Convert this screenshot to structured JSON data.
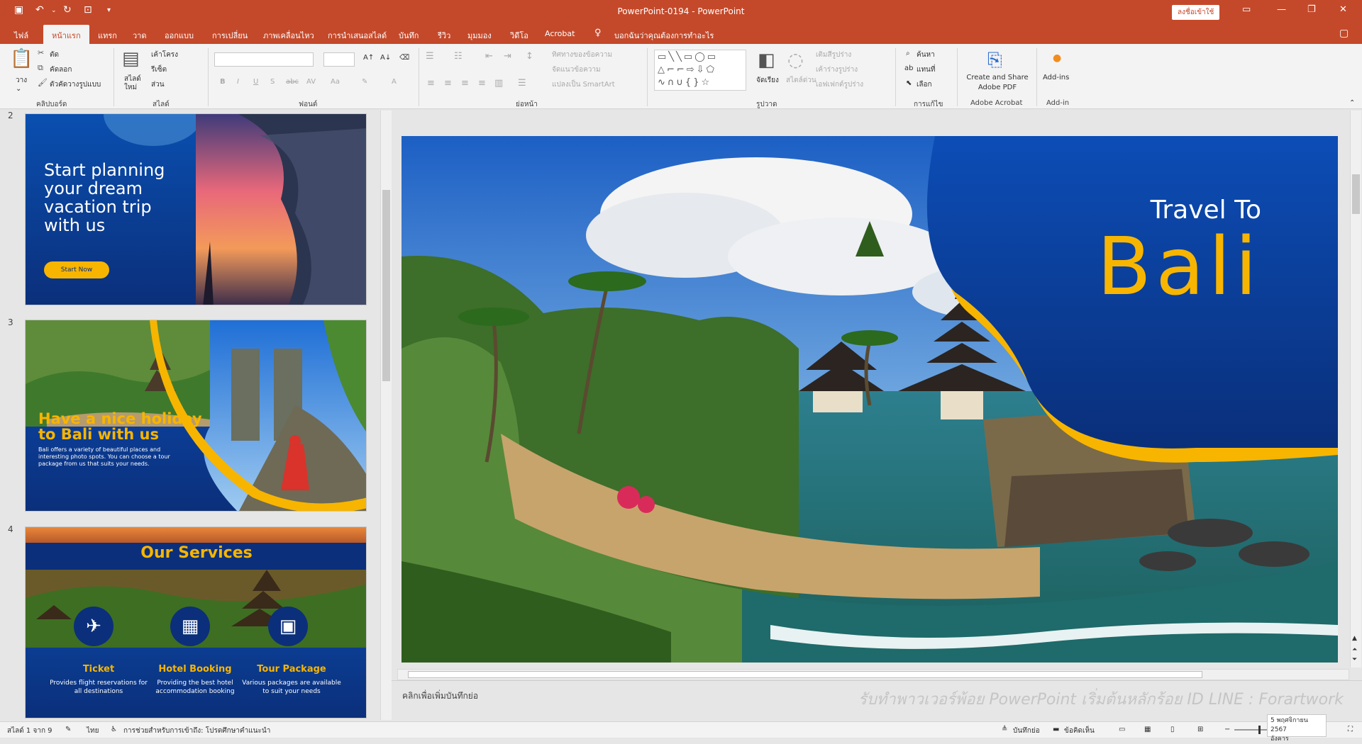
{
  "app": {
    "title": "PowerPoint-0194 - PowerPoint",
    "signin_label": "ลงชื่อเข้าใช้",
    "accent": "#c4492a"
  },
  "quick_access": {
    "icons": [
      "save-icon",
      "undo-icon",
      "redo-icon",
      "slideshow-icon",
      "customize-icon"
    ]
  },
  "tabs": [
    {
      "label": "ไฟล์"
    },
    {
      "label": "หน้าแรก",
      "active": true
    },
    {
      "label": "แทรก"
    },
    {
      "label": "วาด"
    },
    {
      "label": "ออกแบบ"
    },
    {
      "label": "การเปลี่ยน"
    },
    {
      "label": "ภาพเคลื่อนไหว"
    },
    {
      "label": "การนำเสนอสไลด์"
    },
    {
      "label": "บันทึก"
    },
    {
      "label": "รีวิว"
    },
    {
      "label": "มุมมอง"
    },
    {
      "label": "วิดีโอ"
    },
    {
      "label": "Acrobat"
    }
  ],
  "tell_me": "บอกฉันว่าคุณต้องการทำอะไร",
  "ribbon": {
    "clipboard": {
      "paste": "วาง",
      "cut": "ตัด",
      "copy": "คัดลอก",
      "format_painter": "ตัวคัดวางรูปแบบ",
      "label": "คลิปบอร์ด"
    },
    "slides": {
      "new_slide": "สไลด์ใหม่",
      "layout": "เค้าโครง",
      "reset": "รีเซ็ต",
      "section": "ส่วน",
      "label": "สไลด์"
    },
    "font": {
      "label": "ฟอนต์",
      "bold": "B",
      "italic": "I",
      "underline": "U",
      "shadow": "S",
      "strike": "abc",
      "case": "Aa"
    },
    "paragraph": {
      "text_direction": "ทิศทางของข้อความ",
      "align_text": "จัดแนวข้อความ",
      "smartart": "แปลงเป็น SmartArt",
      "label": "ย่อหน้า"
    },
    "drawing": {
      "arrange": "จัดเรียง",
      "quick_styles": "สไตล์ด่วน",
      "fill": "เติมสีรูปร่าง",
      "outline": "เค้าร่างรูปร่าง",
      "effects": "เอฟเฟกต์รูปร่าง",
      "label": "รูปวาด"
    },
    "editing": {
      "find": "ค้นหา",
      "replace": "แทนที่",
      "select": "เลือก",
      "label": "การแก้ไข"
    },
    "acrobat": {
      "line1": "Create and Share",
      "line2": "Adobe PDF",
      "label": "Adobe Acrobat"
    },
    "addins": {
      "button": "Add-ins",
      "label": "Add-in"
    }
  },
  "thumbnails": [
    {
      "number": "2",
      "heading": "Start planning your dream vacation trip with us",
      "button": "Start Now"
    },
    {
      "number": "3",
      "heading": "Have a nice holiday to Bali with us",
      "body": "Bali offers a variety of beautiful places and interesting photo spots. You can choose a tour package from us that suits your needs."
    },
    {
      "number": "4",
      "heading": "Our Services",
      "services": [
        {
          "title": "Ticket",
          "desc": "Provides flight reservations for all destinations",
          "icon": "plane-icon"
        },
        {
          "title": "Hotel Booking",
          "desc": "Providing the best hotel accommodation booking",
          "icon": "hotel-icon"
        },
        {
          "title": "Tour Package",
          "desc": "Various packages are available to suit your needs",
          "icon": "luggage-icon"
        }
      ]
    }
  ],
  "main_slide": {
    "line1": "Travel To",
    "line2": "Bali"
  },
  "notes": {
    "placeholder": "คลิกเพื่อเพิ่มบันทึกย่อ",
    "watermark": "รับทำพาวเวอร์พ้อย PowerPoint เริ่มต้นหลักร้อย ID LINE : Forartwork"
  },
  "status": {
    "slide_counter": "สไลด์ 1 จาก 9",
    "language": "ไทย",
    "accessibility": "การช่วยสำหรับการเข้าถึง: โปรดศึกษาคำแนะนำ",
    "notes_btn": "บันทึกย่อ",
    "comments_btn": "ข้อคิดเห็น",
    "date": "5 พฤศจิกายน 2567",
    "day": "อังคาร"
  },
  "colors": {
    "navy": "#0b2f7a",
    "gold": "#f7b500"
  }
}
